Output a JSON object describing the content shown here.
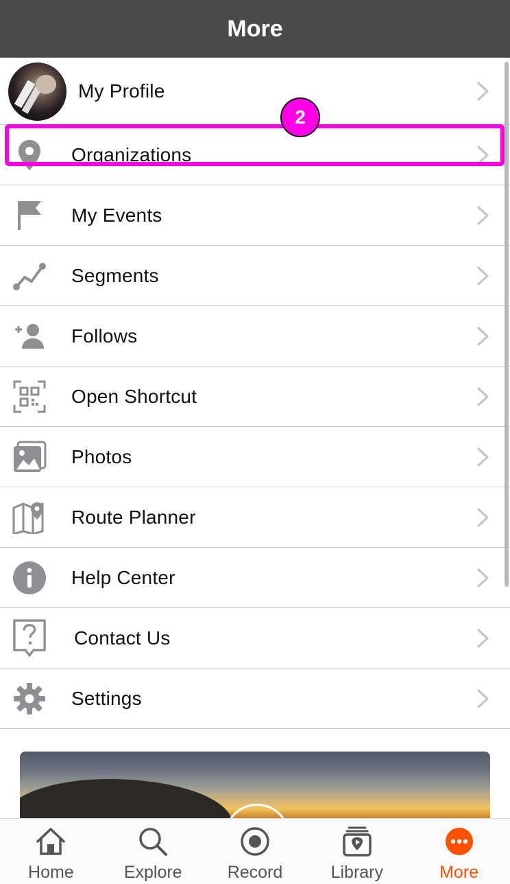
{
  "header": {
    "title": "More"
  },
  "profile": {
    "label": "My Profile"
  },
  "menu": [
    {
      "label": "Organizations",
      "icon": "location-pin-icon"
    },
    {
      "label": "My Events",
      "icon": "flag-icon"
    },
    {
      "label": "Segments",
      "icon": "segments-icon"
    },
    {
      "label": "Follows",
      "icon": "add-person-icon"
    },
    {
      "label": "Open Shortcut",
      "icon": "qr-code-icon"
    },
    {
      "label": "Photos",
      "icon": "photos-icon"
    },
    {
      "label": "Route Planner",
      "icon": "map-pin-icon"
    },
    {
      "label": "Help Center",
      "icon": "info-icon"
    },
    {
      "label": "Contact Us",
      "icon": "question-bubble-icon"
    },
    {
      "label": "Settings",
      "icon": "gear-icon"
    }
  ],
  "annotation": {
    "badge": "2",
    "color": "#ff00e6"
  },
  "tabs": [
    {
      "label": "Home",
      "icon": "home-icon"
    },
    {
      "label": "Explore",
      "icon": "search-icon"
    },
    {
      "label": "Record",
      "icon": "record-icon"
    },
    {
      "label": "Library",
      "icon": "library-icon"
    },
    {
      "label": "More",
      "icon": "more-icon",
      "active": true
    }
  ],
  "colors": {
    "accent": "#fc5200",
    "header": "#4a4a4a",
    "icon": "#8e8e93"
  }
}
